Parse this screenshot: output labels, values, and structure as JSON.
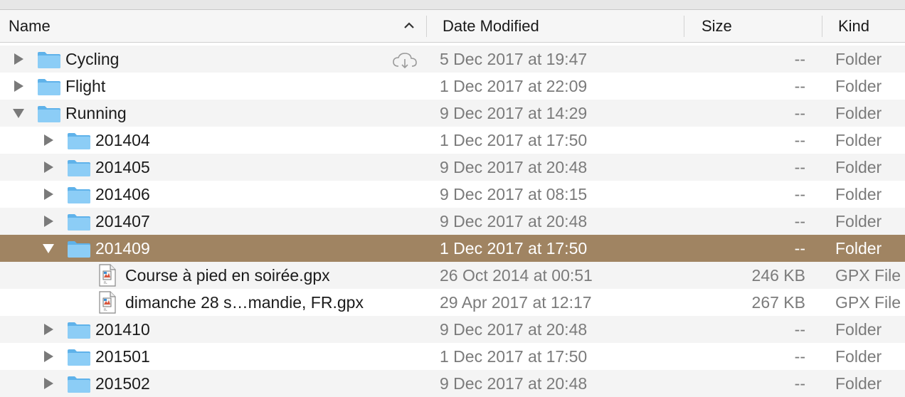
{
  "header": {
    "name": "Name",
    "date_modified": "Date Modified",
    "size": "Size",
    "kind": "Kind"
  },
  "rows": [
    {
      "name": "Cycling",
      "date": "5 Dec 2017 at 19:47",
      "size": "--",
      "kind": "Folder"
    },
    {
      "name": "Flight",
      "date": "1 Dec 2017 at 22:09",
      "size": "--",
      "kind": "Folder"
    },
    {
      "name": "Running",
      "date": "9 Dec 2017 at 14:29",
      "size": "--",
      "kind": "Folder"
    },
    {
      "name": "201404",
      "date": "1 Dec 2017 at 17:50",
      "size": "--",
      "kind": "Folder"
    },
    {
      "name": "201405",
      "date": "9 Dec 2017 at 20:48",
      "size": "--",
      "kind": "Folder"
    },
    {
      "name": "201406",
      "date": "9 Dec 2017 at 08:15",
      "size": "--",
      "kind": "Folder"
    },
    {
      "name": "201407",
      "date": "9 Dec 2017 at 20:48",
      "size": "--",
      "kind": "Folder"
    },
    {
      "name": "201409",
      "date": "1 Dec 2017 at 17:50",
      "size": "--",
      "kind": "Folder"
    },
    {
      "name": "Course à pied en soirée.gpx",
      "date": "26 Oct 2014 at 00:51",
      "size": "246 KB",
      "kind": "GPX File"
    },
    {
      "name": "dimanche 28 s…mandie, FR.gpx",
      "date": "29 Apr 2017 at 12:17",
      "size": "267 KB",
      "kind": "GPX File"
    },
    {
      "name": "201410",
      "date": "9 Dec 2017 at 20:48",
      "size": "--",
      "kind": "Folder"
    },
    {
      "name": "201501",
      "date": "1 Dec 2017 at 17:50",
      "size": "--",
      "kind": "Folder"
    },
    {
      "name": "201502",
      "date": "9 Dec 2017 at 20:48",
      "size": "--",
      "kind": "Folder"
    }
  ],
  "colors": {
    "selection": "#a08462",
    "folder": "#7cc3f2",
    "secondary_text": "#7b7b7b"
  },
  "icons": {
    "folder": "folder-icon",
    "document": "gpx-document-icon",
    "disclosure_collapsed": "disclosure-right-icon",
    "disclosure_expanded": "disclosure-down-icon",
    "cloud": "icloud-download-icon",
    "sort": "sort-ascending-icon"
  }
}
